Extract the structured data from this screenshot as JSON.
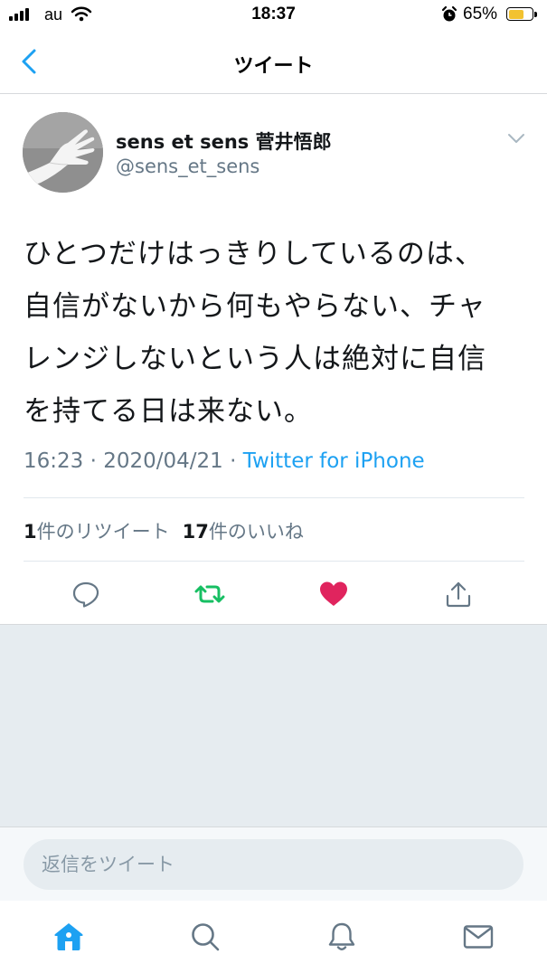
{
  "status_bar": {
    "carrier": "au",
    "time": "18:37",
    "battery_percent": "65%",
    "battery_level": 0.65,
    "battery_color": "#f2c230"
  },
  "nav": {
    "title": "ツイート",
    "back_icon": "chevron-left-icon"
  },
  "tweet": {
    "author_name": "sens et sens 菅井悟郎",
    "author_handle": "@sens_et_sens",
    "text": "ひとつだけはっきりしているのは、自信がないから何もやらない、チャレンジしないという人は絶対に自信を持てる日は来ない。",
    "timestamp": "16:23 · 2020/04/21 · ",
    "source": "Twitter for iPhone",
    "retweet_count": "1",
    "retweet_label": "件のリツイート",
    "like_count": "17",
    "like_label": "件のいいね"
  },
  "actions": [
    {
      "icon": "reply-icon"
    },
    {
      "icon": "retweet-icon",
      "color": "#17bf63"
    },
    {
      "icon": "heart-icon",
      "color": "#e0245e"
    },
    {
      "icon": "share-icon"
    }
  ],
  "reply": {
    "placeholder": "返信をツイート"
  },
  "tabbar": [
    {
      "icon": "home-icon",
      "active": true
    },
    {
      "icon": "search-icon"
    },
    {
      "icon": "bell-icon"
    },
    {
      "icon": "mail-icon"
    }
  ],
  "colors": {
    "accent": "#1da1f2",
    "secondary_text": "#657786",
    "background_grey": "#e6ecf0"
  }
}
